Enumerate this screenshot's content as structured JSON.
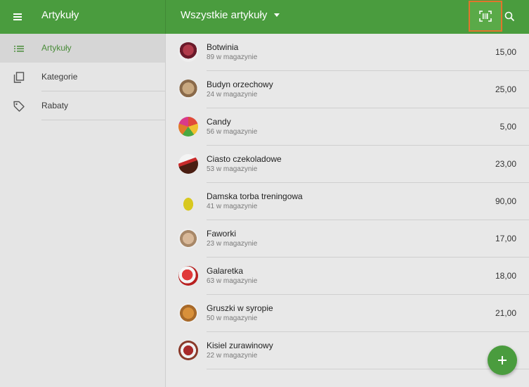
{
  "app_title": "Artykuły",
  "main_title": "Wszystkie artykuły",
  "colors": {
    "appbar": "#4a9c3e",
    "scan_highlight": "#e2742c",
    "active_nav": "#4a8c3a",
    "fab": "#4a9c3e"
  },
  "icons": {
    "menu": "menu-icon",
    "dropdown": "chevron-down-icon",
    "scan": "barcode-scan-icon",
    "search": "search-icon",
    "add": "plus-icon"
  },
  "sidebar": {
    "items": [
      {
        "label": "Artykuły",
        "icon": "list-icon",
        "active": true
      },
      {
        "label": "Kategorie",
        "icon": "copy-icon",
        "active": false
      },
      {
        "label": "Rabaty",
        "icon": "tag-icon",
        "active": false
      }
    ]
  },
  "items": [
    {
      "name": "Botwinia",
      "stock": "89 w magazynie",
      "price": "15,00",
      "color": "#8a2a3a"
    },
    {
      "name": "Budyn orzechowy",
      "stock": "24 w magazynie",
      "price": "25,00",
      "color": "#b89a7a"
    },
    {
      "name": "Candy",
      "stock": "56 w magazynie",
      "price": "5,00",
      "color": "#d84a3a"
    },
    {
      "name": "Ciasto czekoladowe",
      "stock": "53 w magazynie",
      "price": "23,00",
      "color": "#5a2a1a"
    },
    {
      "name": "Damska torba treningowa",
      "stock": "41 w magazynie",
      "price": "90,00",
      "color": "#d8c820"
    },
    {
      "name": "Faworki",
      "stock": "23 w magazynie",
      "price": "17,00",
      "color": "#c8a888"
    },
    {
      "name": "Galaretka",
      "stock": "63 w magazynie",
      "price": "18,00",
      "color": "#c82a2a"
    },
    {
      "name": "Gruszki w syropie",
      "stock": "50 w magazynie",
      "price": "21,00",
      "color": "#c8883a"
    },
    {
      "name": "Kisiel zurawinowy",
      "stock": "22 w magazynie",
      "price": "",
      "color": "#9a2a2a"
    }
  ]
}
